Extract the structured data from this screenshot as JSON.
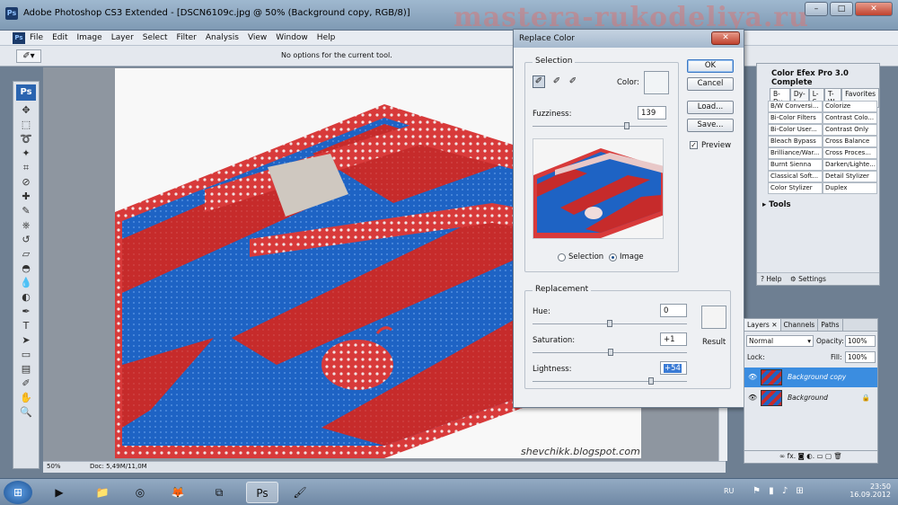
{
  "window": {
    "title": "Adobe Photoshop CS3 Extended - [DSCN6109c.jpg @ 50% (Background copy, RGB/8)]",
    "app_icon": "Ps",
    "minimize": "–",
    "maximize": "□",
    "close": "✕"
  },
  "watermark": "mastera-rukodeliya.ru",
  "menu": {
    "items": [
      "File",
      "Edit",
      "Image",
      "Layer",
      "Select",
      "Filter",
      "Analysis",
      "View",
      "Window",
      "Help"
    ]
  },
  "options_bar": {
    "message": "No options for the current tool."
  },
  "toolbox": {
    "logo": "Ps",
    "tools": [
      "move-icon",
      "marquee-icon",
      "lasso-icon",
      "magic-wand-icon",
      "crop-icon",
      "slice-icon",
      "healing-icon",
      "brush-icon",
      "stamp-icon",
      "history-brush-icon",
      "eraser-icon",
      "paint-bucket-icon",
      "blur-icon",
      "dodge-icon",
      "pen-icon",
      "type-icon",
      "path-select-icon",
      "shape-icon",
      "notes-icon",
      "eyedropper-icon",
      "hand-icon",
      "zoom-icon"
    ],
    "glyphs": [
      "✥",
      "⬚",
      "➰",
      "✦",
      "⌗",
      "⊘",
      "✚",
      "✎",
      "⎈",
      "↺",
      "▱",
      "◓",
      "💧",
      "◐",
      "✒",
      "T",
      "➤",
      "▭",
      "▤",
      "✐",
      "✋",
      "🔍"
    ]
  },
  "canvas": {
    "credit": "shevchikk.blogspot.com"
  },
  "status": {
    "zoom": "50%",
    "doc": "Doc: 5,49M/11,0M"
  },
  "replace_color": {
    "title": "Replace Color",
    "close": "✕",
    "selection_legend": "Selection",
    "color_label": "Color:",
    "fuzziness_label": "Fuzziness:",
    "fuzziness_value": "139",
    "fuzziness_fraction": 0.7,
    "radio_selection": "Selection",
    "radio_image": "Image",
    "replacement_legend": "Replacement",
    "hue_label": "Hue:",
    "hue_value": "0",
    "hue_fraction": 0.5,
    "saturation_label": "Saturation:",
    "saturation_value": "+1",
    "saturation_fraction": 0.505,
    "lightness_label": "Lightness:",
    "lightness_value": "+54",
    "lightness_fraction": 0.77,
    "result_label": "Result",
    "buttons": {
      "ok": "OK",
      "cancel": "Cancel",
      "load": "Load...",
      "save": "Save..."
    },
    "preview_label": "Preview",
    "preview_checked": "✓"
  },
  "efex": {
    "title": "Color Efex Pro 3.0 Complete",
    "tabs": [
      "B-Du",
      "Dy-I",
      "L-S",
      "T-W",
      "Favorites"
    ],
    "filters": [
      [
        "B/W Conversi...",
        "Colorize"
      ],
      [
        "Bi-Color Filters",
        "Contrast Colo..."
      ],
      [
        "Bi-Color User...",
        "Contrast Only"
      ],
      [
        "Bleach Bypass",
        "Cross Balance"
      ],
      [
        "Brilliance/War...",
        "Cross Proces..."
      ],
      [
        "Burnt Sienna",
        "Darken/Lighte..."
      ],
      [
        "Classical Soft...",
        "Detail Stylizer"
      ],
      [
        "Color Stylizer",
        "Duplex"
      ]
    ],
    "tools_label": "Tools",
    "help": "Help",
    "settings": "Settings"
  },
  "layers_panel": {
    "tabs": [
      "Layers ✕",
      "Channels",
      "Paths"
    ],
    "blend_mode": "Normal",
    "opacity_label": "Opacity:",
    "opacity_value": "100%",
    "lock_label": "Lock:",
    "fill_label": "Fill:",
    "fill_value": "100%",
    "layers": [
      "Background copy",
      "Background"
    ],
    "bottom_icons": "∞  fx.  ◙  ◐.  ▭  ▢  🗑"
  },
  "taskbar": {
    "lang": "RU",
    "time": "23:50",
    "date": "16.09.2012",
    "start": "⊞",
    "apps": [
      "▶",
      "📁",
      "◎",
      "🦊",
      "⧉",
      "Ps",
      "🖌"
    ]
  },
  "colors": {
    "fabric_red": "#c62b2b",
    "fabric_blue": "#1e63c4",
    "selected_layer": "#3b8de0"
  }
}
